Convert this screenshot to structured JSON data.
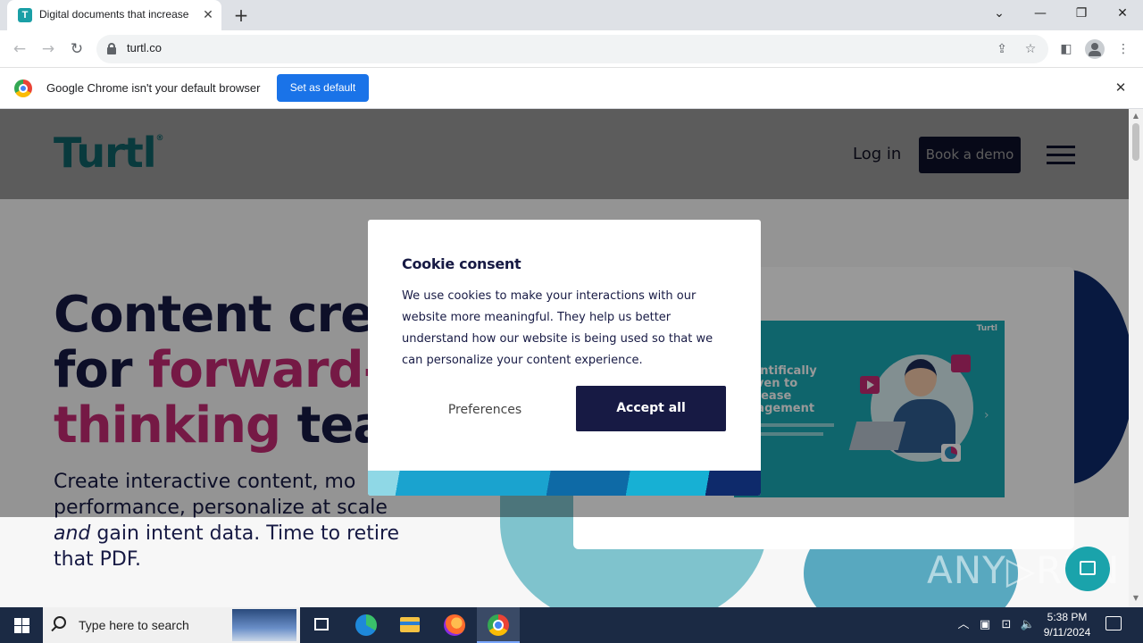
{
  "browser": {
    "tab_title": "Digital documents that increase",
    "tab_favicon_letter": "T",
    "url": "turtl.co",
    "new_tab_symbol": "+",
    "tab_close_symbol": "✕"
  },
  "infobar": {
    "message": "Google Chrome isn't your default browser",
    "button": "Set as default"
  },
  "site": {
    "logo": "Turtl",
    "logo_mark": "®",
    "login": "Log in",
    "demo": "Book a demo",
    "hero": {
      "line1": "Content crea",
      "line2_a": "for ",
      "line2_b": "forward-",
      "line3_a": "thinking",
      "line3_b": " tean",
      "sub_a": "Create interactive content, mo performance, personalize at scale ",
      "sub_em": "and",
      "sub_b": " gain intent data. Time to retire that PDF."
    },
    "preview": {
      "brand": "Turtl",
      "headline": "ientifically\noven to\ncrease\ngagement"
    }
  },
  "cookie_modal": {
    "title": "Cookie consent",
    "body": "We use cookies to make your interactions with our website more meaningful. They help us better understand how our website is being used so that we can personalize your content experience.",
    "preferences": "Preferences",
    "accept": "Accept all"
  },
  "watermark": "ANY▷RUN",
  "taskbar": {
    "search_placeholder": "Type here to search",
    "time": "5:38 PM",
    "date": "9/11/2024"
  },
  "colors": {
    "brand_teal": "#1aa3ab",
    "navy": "#171a44",
    "pink": "#c42a73",
    "chrome_blue": "#1a73e8"
  }
}
